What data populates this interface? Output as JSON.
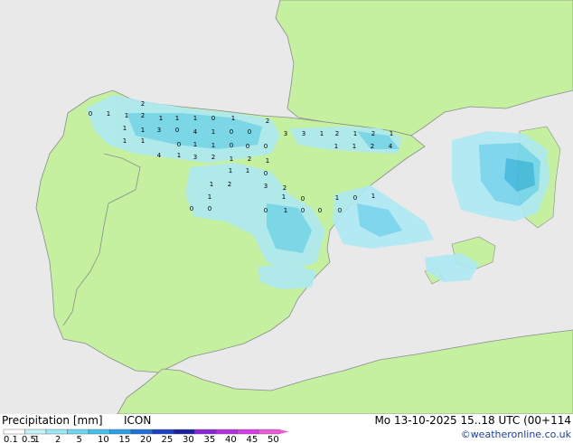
{
  "footer": {
    "title": "Precipitation [mm]",
    "model": "ICON",
    "validity": "Mo 13-10-2025 15..18 UTC (00+114",
    "credit": "©weatheronline.co.uk"
  },
  "colors": {
    "sea": "#e9e9ea",
    "land": "#c4f0a0",
    "border": "#8c8c8c",
    "precip_light": "#aee9f3",
    "precip_mid": "#74d4ee",
    "precip_heavy": "#3fb8e0"
  },
  "scale": {
    "labels": [
      "0.1",
      "0.5",
      "1",
      "2",
      "5",
      "10",
      "15",
      "20",
      "25",
      "30",
      "35",
      "40",
      "45",
      "50"
    ],
    "colors": [
      "#ffffff",
      "#c4f2f8",
      "#9ae7f5",
      "#6fd6f0",
      "#45c0eb",
      "#2a9ee6",
      "#1f6fd9",
      "#1c3fc6",
      "#1c1f9e",
      "#8a24d8",
      "#b22ee0",
      "#d63ce8",
      "#ec5ad8"
    ]
  },
  "map_values": [
    "0",
    "2",
    "1",
    "1",
    "2",
    "1",
    "1",
    "1",
    "0",
    "1",
    "2",
    "1",
    "1",
    "3",
    "0",
    "4",
    "1",
    "0",
    "0",
    "1",
    "1",
    "0",
    "1",
    "1",
    "0",
    "0",
    "0",
    "3",
    "3",
    "1",
    "2",
    "1",
    "2",
    "1",
    "1",
    "1",
    "2",
    "4",
    "4",
    "1",
    "3",
    "2",
    "1",
    "2",
    "1",
    "1",
    "1",
    "0",
    "1",
    "2",
    "3",
    "2",
    "1",
    "1",
    "0",
    "1",
    "0",
    "1",
    "0",
    "0",
    "0",
    "1",
    "0",
    "0",
    "0"
  ]
}
